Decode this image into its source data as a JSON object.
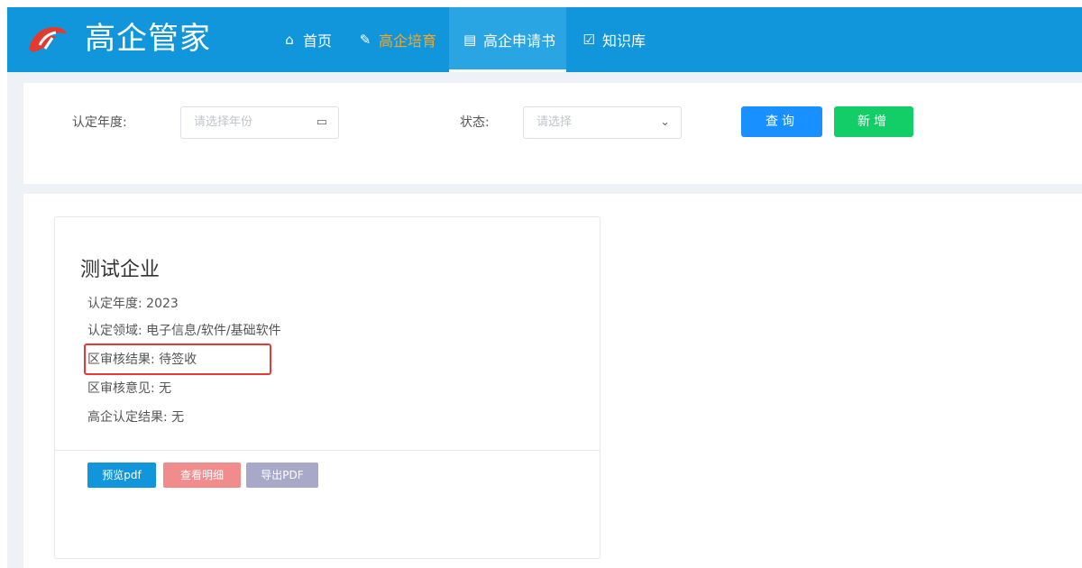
{
  "app": {
    "title": "高企管家",
    "brand_color": "#1296db"
  },
  "nav": [
    {
      "icon": "home-icon",
      "label": "首页",
      "active": false
    },
    {
      "icon": "pen-icon",
      "label": "高企培育",
      "active": false
    },
    {
      "icon": "document-icon",
      "label": "高企申请书",
      "active": true
    },
    {
      "icon": "book-icon",
      "label": "知识库",
      "active": false
    }
  ],
  "filters": {
    "year_label": "认定年度:",
    "year_placeholder": "请选择年份",
    "status_label": "状态:",
    "status_placeholder": "请选择",
    "query_label": "查询",
    "add_label": "新增"
  },
  "card": {
    "company": "测试企业",
    "lines": [
      "认定年度: 2023",
      "认定领域: 电子信息/软件/基础软件",
      "区审核结果: 待签收",
      "区审核意见: 无",
      "高企认定结果: 无"
    ],
    "buttons": {
      "preview": "预览pdf",
      "detail": "查看明细",
      "export": "导出PDF"
    }
  }
}
